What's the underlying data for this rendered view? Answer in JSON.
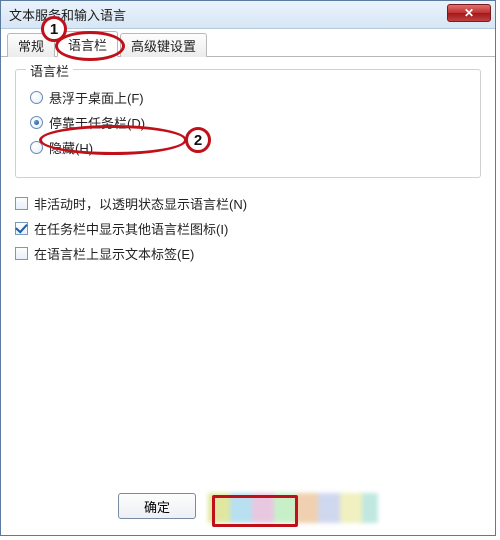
{
  "window": {
    "title": "文本服务和输入语言"
  },
  "tabs": {
    "general": "常规",
    "language_bar": "语言栏",
    "advanced": "高级键设置"
  },
  "group": {
    "legend": "语言栏",
    "radio_float": "悬浮于桌面上(F)",
    "radio_dock": "停靠于任务栏(D)",
    "radio_hidden": "隐藏(H)"
  },
  "checks": {
    "transparent": "非活动时，以透明状态显示语言栏(N)",
    "extra_icons": "在任务栏中显示其他语言栏图标(I)",
    "text_labels": "在语言栏上显示文本标签(E)"
  },
  "buttons": {
    "ok": "确定"
  },
  "annotations": {
    "one": "1",
    "two": "2"
  }
}
